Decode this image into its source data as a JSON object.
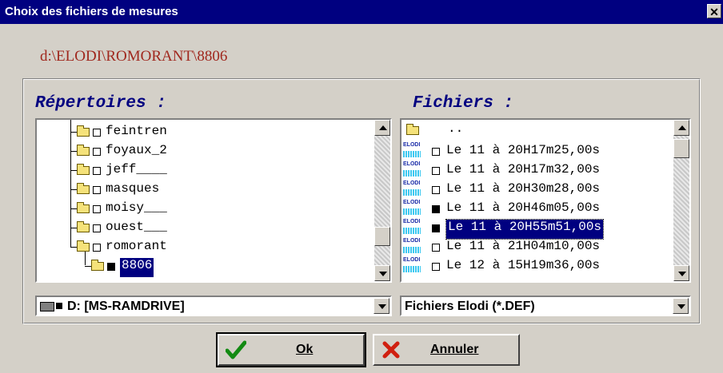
{
  "window": {
    "title": "Choix des fichiers de mesures",
    "close_label": "✕"
  },
  "current_path": "d:\\ELODI\\ROMORANT\\8806",
  "directories": {
    "heading": "Répertoires :",
    "items": [
      {
        "name": "feintren",
        "state": "unchecked"
      },
      {
        "name": "foyaux_2",
        "state": "unchecked"
      },
      {
        "name": "jeff____",
        "state": "unchecked"
      },
      {
        "name": "masques",
        "state": "unchecked"
      },
      {
        "name": "moisy___",
        "state": "unchecked"
      },
      {
        "name": "ouest___",
        "state": "unchecked"
      },
      {
        "name": "romorant",
        "state": "unchecked",
        "open": true
      },
      {
        "name": "8806",
        "state": "filled",
        "selected": true
      }
    ]
  },
  "files": {
    "heading": "Fichiers :",
    "parent_label": "..",
    "icon_label": "ELODI",
    "items": [
      {
        "name": "Le 11 à 20H17m25,00s",
        "checked": false
      },
      {
        "name": "Le 11 à 20H17m32,00s",
        "checked": false
      },
      {
        "name": "Le 11 à 20H30m28,00s",
        "checked": false
      },
      {
        "name": "Le 11 à 20H46m05,00s",
        "checked": true
      },
      {
        "name": "Le 11 à 20H55m51,00s",
        "checked": true,
        "selected": true
      },
      {
        "name": "Le 11 à 21H04m10,00s",
        "checked": false
      },
      {
        "name": "Le 12 à 15H19m36,00s",
        "checked": false
      }
    ]
  },
  "drive_combo": {
    "value": "D: [MS-RAMDRIVE]"
  },
  "filter_combo": {
    "value": "Fichiers Elodi (*.DEF)"
  },
  "buttons": {
    "ok_label": "Ok",
    "cancel_label": "Annuler"
  },
  "colors": {
    "titlebar": "#000080",
    "path_text": "#a0281e",
    "heading_text": "#000080",
    "selection": "#000080"
  }
}
